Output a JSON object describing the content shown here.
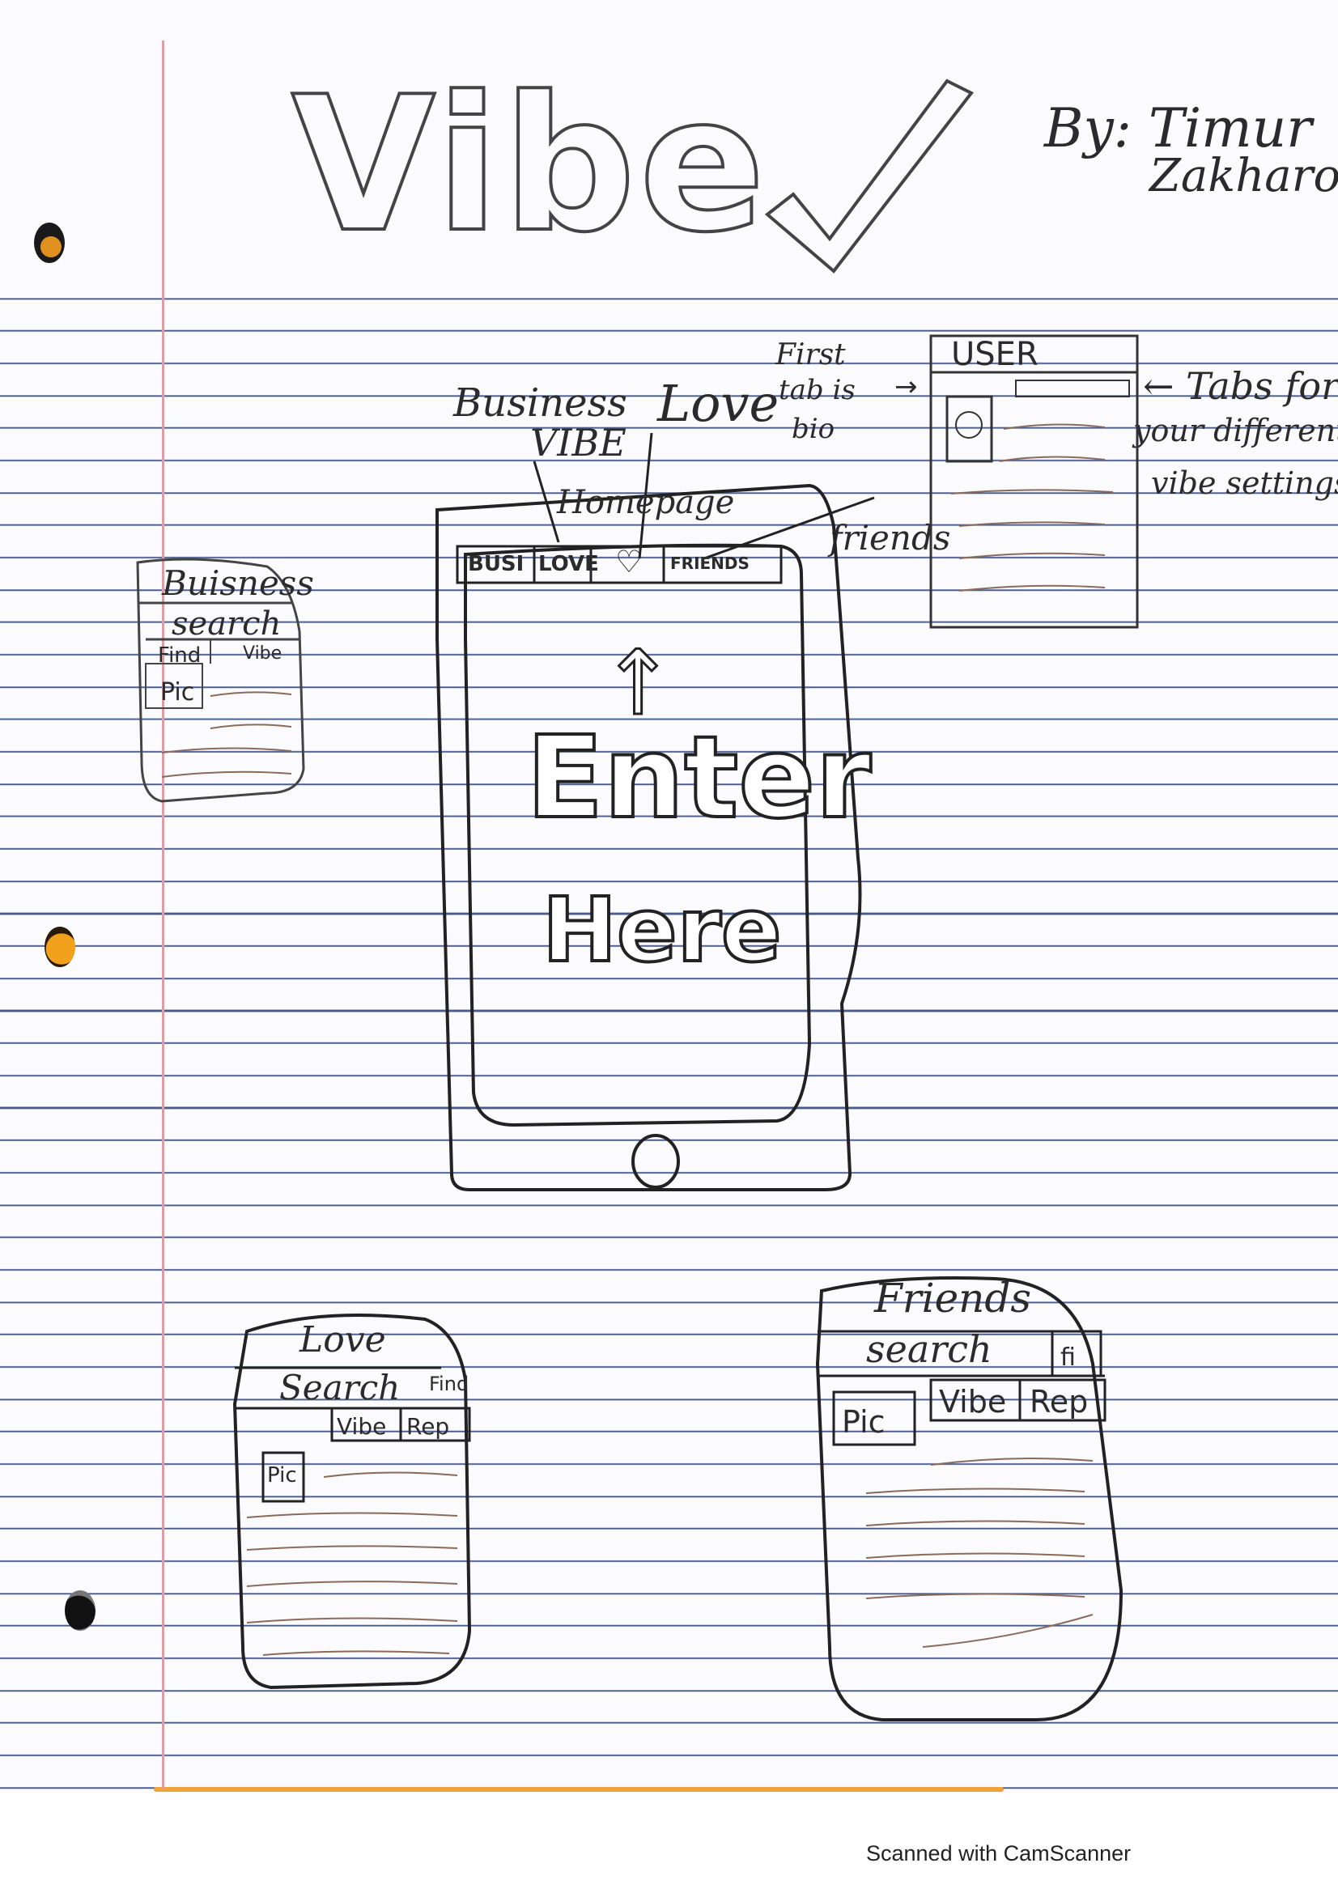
{
  "title": "Vibe",
  "author": {
    "by": "By: Timur",
    "name": "Zakharov"
  },
  "home": {
    "label": "Homepage",
    "tabs": [
      "BUSI",
      "LOVE",
      "♡",
      "FRIENDS"
    ],
    "arrow": "↑",
    "cta_line1": "Enter",
    "cta_line2": "Here"
  },
  "annotations": {
    "business": "Business",
    "vibe": "VIBE",
    "love": "Love",
    "first_tab_1": "First",
    "first_tab_2": "tab is",
    "first_tab_3": "bio",
    "friends": "friends",
    "tabs_note_1": "← Tabs for",
    "tabs_note_2": "your different",
    "tabs_note_3": "vibe settings"
  },
  "user_card": {
    "title": "USER"
  },
  "business_card": {
    "title": "Buisness",
    "search": "search",
    "find": "Find",
    "vibe": "Vibe",
    "pic": "Pic"
  },
  "love_card": {
    "title": "Love",
    "search": "Search",
    "find": "Find",
    "vibe": "Vibe",
    "rep": "Rep",
    "pic": "Pic"
  },
  "friends_card": {
    "title": "Friends",
    "search": "search",
    "find": "fi",
    "vibe": "Vibe",
    "rep": "Rep",
    "pic": "Pic"
  },
  "caption": "Scanned with CamScanner"
}
